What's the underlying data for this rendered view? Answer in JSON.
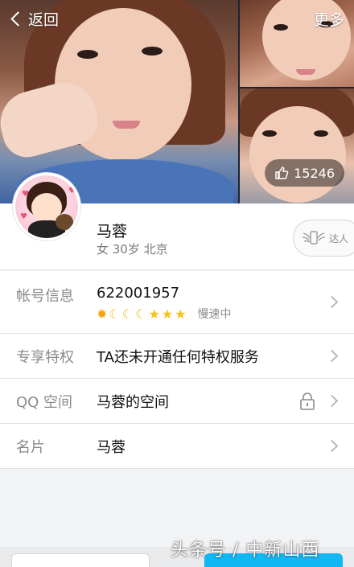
{
  "header": {
    "back_label": "返回",
    "more_label": "更多",
    "likes_count": "15246"
  },
  "profile": {
    "name": "马蓉",
    "info": "女 30岁 北京",
    "talent_label": "达人"
  },
  "rows": {
    "account": {
      "label": "帐号信息",
      "value": "622001957",
      "level_icons": [
        "sun-icon",
        "moon-icon",
        "moon-icon",
        "moon-icon",
        "star-icon",
        "star-icon",
        "star-icon"
      ],
      "speed_status": "慢速中"
    },
    "privilege": {
      "label": "专享特权",
      "value": "TA还未开通任何特权服务"
    },
    "qzone": {
      "label": "QQ 空间",
      "value": "马蓉的空间"
    },
    "card": {
      "label": "名片",
      "value": "马蓉"
    }
  },
  "watermark": "头条号 / 中新山西",
  "colors": {
    "accent_blue": "#12b7f5",
    "level_gold": "#f6c214",
    "label_gray": "#8a8a8a"
  }
}
